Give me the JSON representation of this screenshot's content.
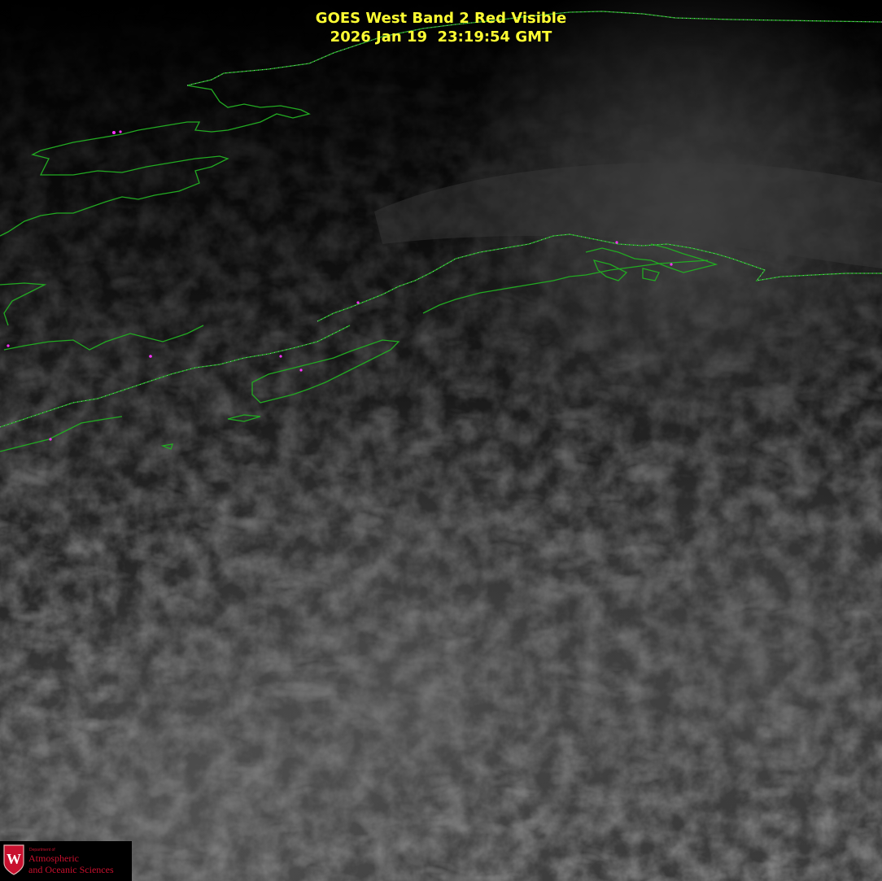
{
  "image": {
    "title_line1": "GOES West Band 2 Red Visible",
    "title_line2": "2026 Jan 19  23:19:54 GMT",
    "title_color": "#ffff33",
    "coastline_color": "#22aa22",
    "coastline_dot_color": "#bb99cc",
    "city_marker_color": "#ff33ff"
  },
  "logo": {
    "department_line": "Department of",
    "line1": "Atmospheric",
    "line2": "and Oceanic Sciences",
    "emblem_letter": "W",
    "emblem_color": "#c8102e"
  }
}
